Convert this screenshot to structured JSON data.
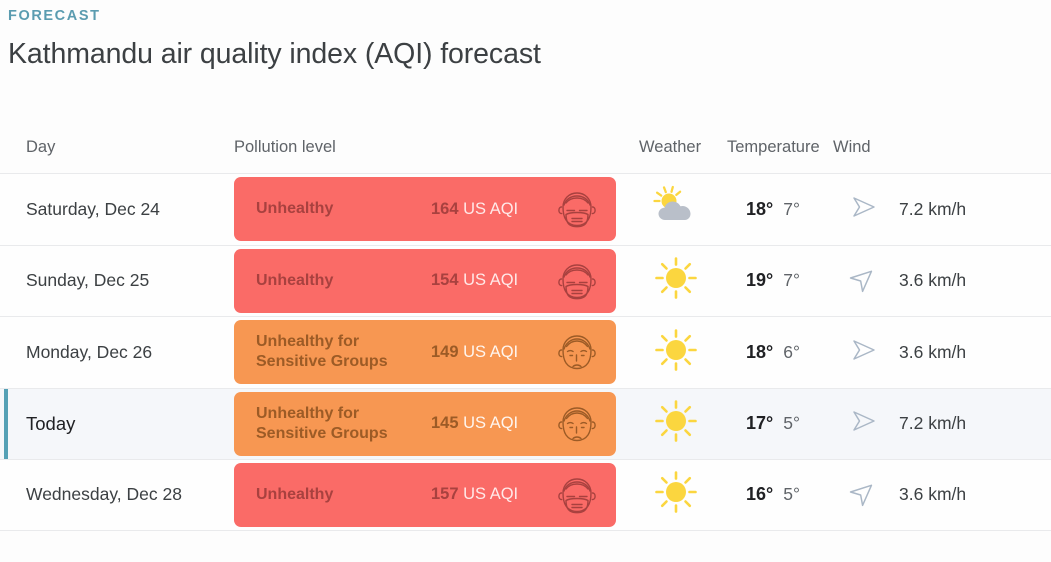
{
  "header": {
    "eyebrow": "FORECAST",
    "title": "Kathmandu air quality index (AQI) forecast"
  },
  "colors": {
    "accent_teal": "#54a0b5",
    "eyebrow_teal": "#5b9cb0",
    "unhealthy_red": "#fa6b67",
    "sensitive_orange": "#f79752",
    "today_row_bg": "#f5f7fa",
    "sun_yellow": "#fbd63f",
    "cloud_grey": "#b9bfc9",
    "wind_arrow": "#aab7c6"
  },
  "table": {
    "columns": [
      {
        "key": "day",
        "label": "Day"
      },
      {
        "key": "pollution",
        "label": "Pollution level"
      },
      {
        "key": "weather",
        "label": "Weather"
      },
      {
        "key": "temperature",
        "label": "Temperature"
      },
      {
        "key": "wind",
        "label": "Wind"
      }
    ],
    "aqi_unit": "US AQI",
    "rows": [
      {
        "day": "Saturday, Dec 24",
        "is_today": false,
        "level": "Unhealthy",
        "level_class": "red",
        "aqi": "164",
        "face_icon": "masked-face-icon",
        "weather_icon": "partly-cloudy-icon",
        "temp_max": "18°",
        "temp_min": "7°",
        "wind_icon": "wind-direction-arrow-icon",
        "wind_rotation": 0,
        "wind_speed": "7.2 km/h"
      },
      {
        "day": "Sunday, Dec 25",
        "is_today": false,
        "level": "Unhealthy",
        "level_class": "red",
        "aqi": "154",
        "face_icon": "masked-face-icon",
        "weather_icon": "sunny-icon",
        "temp_max": "19°",
        "temp_min": "7°",
        "wind_icon": "wind-direction-arrow-icon",
        "wind_rotation": -42,
        "wind_speed": "3.6 km/h"
      },
      {
        "day": "Monday, Dec 26",
        "is_today": false,
        "level": "Unhealthy for Sensitive Groups",
        "level_line1": "Unhealthy for",
        "level_line2": "Sensitive Groups",
        "level_class": "orange",
        "aqi": "149",
        "face_icon": "sad-face-icon",
        "weather_icon": "sunny-icon",
        "temp_max": "18°",
        "temp_min": "6°",
        "wind_icon": "wind-direction-arrow-icon",
        "wind_rotation": 0,
        "wind_speed": "3.6 km/h"
      },
      {
        "day": "Today",
        "is_today": true,
        "level": "Unhealthy for Sensitive Groups",
        "level_line1": "Unhealthy for",
        "level_line2": "Sensitive Groups",
        "level_class": "orange",
        "aqi": "145",
        "face_icon": "sad-face-icon",
        "weather_icon": "sunny-icon",
        "temp_max": "17°",
        "temp_min": "5°",
        "wind_icon": "wind-direction-arrow-icon",
        "wind_rotation": 0,
        "wind_speed": "7.2 km/h"
      },
      {
        "day": "Wednesday, Dec 28",
        "is_today": false,
        "level": "Unhealthy",
        "level_class": "red",
        "aqi": "157",
        "face_icon": "masked-face-icon",
        "weather_icon": "sunny-icon",
        "temp_max": "16°",
        "temp_min": "5°",
        "wind_icon": "wind-direction-arrow-icon",
        "wind_rotation": -42,
        "wind_speed": "3.6 km/h"
      }
    ]
  }
}
